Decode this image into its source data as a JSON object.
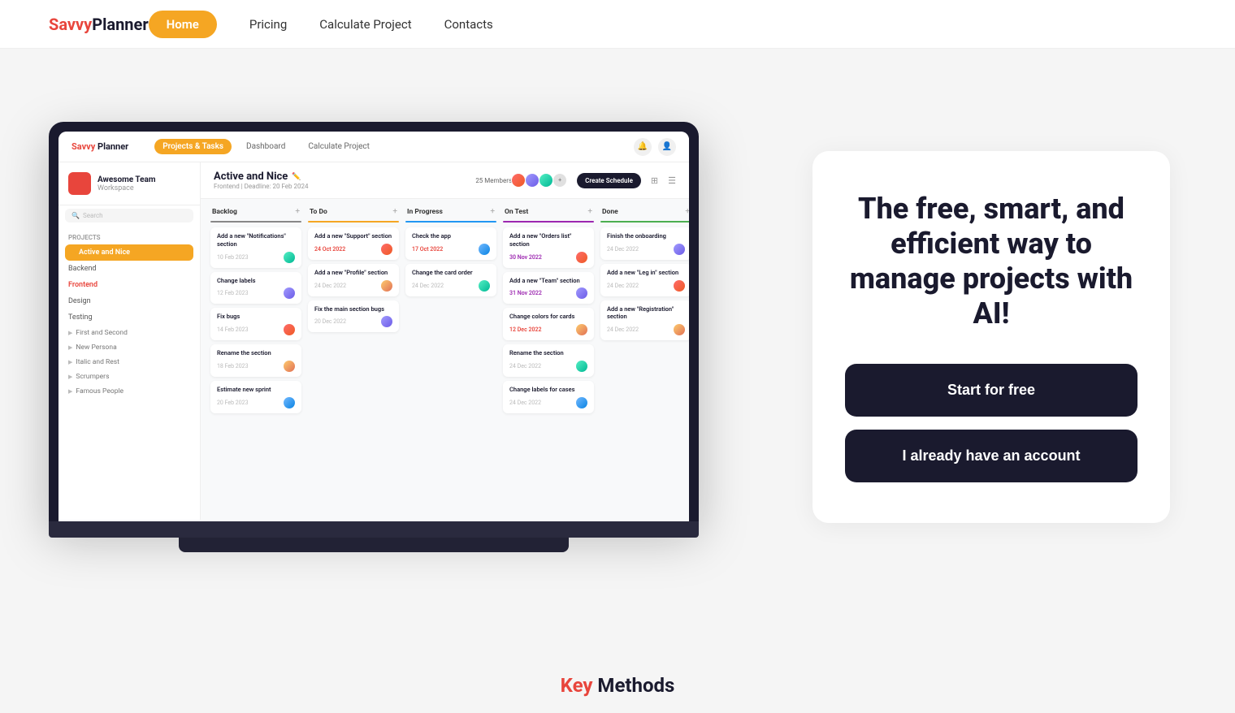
{
  "brand": {
    "savvy": "Savvy",
    "planner": " Planner"
  },
  "nav": {
    "home_label": "Home",
    "pricing_label": "Pricing",
    "calculate_label": "Calculate Project",
    "contacts_label": "Contacts"
  },
  "app_mockup": {
    "nav": {
      "logo_savvy": "Savvy",
      "logo_planner": " Planner",
      "tab_projects": "Projects & Tasks",
      "tab_dashboard": "Dashboard",
      "tab_calculate": "Calculate Project"
    },
    "sidebar": {
      "team_name": "Awesome Team",
      "team_sub": "Workspace",
      "search_placeholder": "Search",
      "section_label": "Projects",
      "active_project": "Active and Nice",
      "items": [
        "Backend",
        "Frontend",
        "Design",
        "Testing"
      ],
      "groups": [
        "First and Second",
        "New Persona",
        "Italic and Rest",
        "Scrumpers",
        "Famous People"
      ]
    },
    "board": {
      "title": "Active and Nice",
      "subtitle": "Frontend | Deadline: 20 Feb 2024",
      "members_count": "25 Members",
      "btn_schedule": "Create Schedule",
      "columns": [
        {
          "id": "backlog",
          "title": "Backlog",
          "color": "#888",
          "cards": [
            {
              "title": "Add a new \"Notifications\" section",
              "date": "10 Feb 2023",
              "avatar_color": "av3",
              "date_type": "normal"
            },
            {
              "title": "Change labels",
              "date": "12 Feb 2023",
              "avatar_color": "av2",
              "date_type": "normal"
            },
            {
              "title": "Fix bugs",
              "date": "14 Feb 2023",
              "avatar_color": "av1",
              "date_type": "normal"
            },
            {
              "title": "Rename the section",
              "date": "18 Feb 2023",
              "avatar_color": "av4",
              "date_type": "normal"
            },
            {
              "title": "Estimate new sprint",
              "date": "20 Feb 2023",
              "avatar_color": "av5",
              "date_type": "normal"
            }
          ]
        },
        {
          "id": "todo",
          "title": "To Do",
          "color": "#f5a623",
          "cards": [
            {
              "title": "Add a new \"Support\" section",
              "date": "24 Oct 2022",
              "avatar_color": "av1",
              "date_type": "red"
            },
            {
              "title": "Add a new \"Profile\" section",
              "date": "24 Dec 2022",
              "avatar_color": "av4",
              "date_type": "normal"
            },
            {
              "title": "Fix the main section bugs",
              "date": "20 Dec 2022",
              "avatar_color": "av2",
              "date_type": "normal"
            }
          ]
        },
        {
          "id": "in_progress",
          "title": "In Progress",
          "color": "#2196f3",
          "cards": [
            {
              "title": "Check the app",
              "date": "17 Oct 2022",
              "avatar_color": "av5",
              "date_type": "red"
            },
            {
              "title": "Change the card order",
              "date": "24 Dec 2022",
              "avatar_color": "av3",
              "date_type": "normal"
            }
          ]
        },
        {
          "id": "on_test",
          "title": "On Test",
          "color": "#9c27b0",
          "cards": [
            {
              "title": "Add a new \"Orders list\" section",
              "date": "30 Nov 2022",
              "avatar_color": "av1",
              "date_type": "purple"
            },
            {
              "title": "Add a new \"Team\" section",
              "date": "31 Nov 2022",
              "avatar_color": "av2",
              "date_type": "purple"
            },
            {
              "title": "Change colors for cards",
              "date": "12 Dec 2022",
              "avatar_color": "av4",
              "date_type": "red"
            },
            {
              "title": "Rename the section",
              "date": "24 Dec 2022",
              "avatar_color": "av3",
              "date_type": "normal"
            },
            {
              "title": "Change labels for cases",
              "date": "24 Dec 2022",
              "avatar_color": "av5",
              "date_type": "normal"
            }
          ]
        },
        {
          "id": "done",
          "title": "Done",
          "color": "#4caf50",
          "cards": [
            {
              "title": "Finish the onboarding",
              "date": "24 Dec 2022",
              "avatar_color": "av2",
              "date_type": "normal"
            },
            {
              "title": "Add a new \"Leg in\" section",
              "date": "24 Dec 2022",
              "avatar_color": "av1",
              "date_type": "normal"
            },
            {
              "title": "Add a new \"Registration\" section",
              "date": "24 Dec 2022",
              "avatar_color": "av4",
              "date_type": "normal"
            }
          ]
        }
      ]
    }
  },
  "hero": {
    "title": "The free, smart, and efficient way to manage projects with AI!",
    "btn_start": "Start for free",
    "btn_login": "I already have an account"
  },
  "bottom": {
    "key_label": "Key",
    "methods_label": " Methods"
  }
}
